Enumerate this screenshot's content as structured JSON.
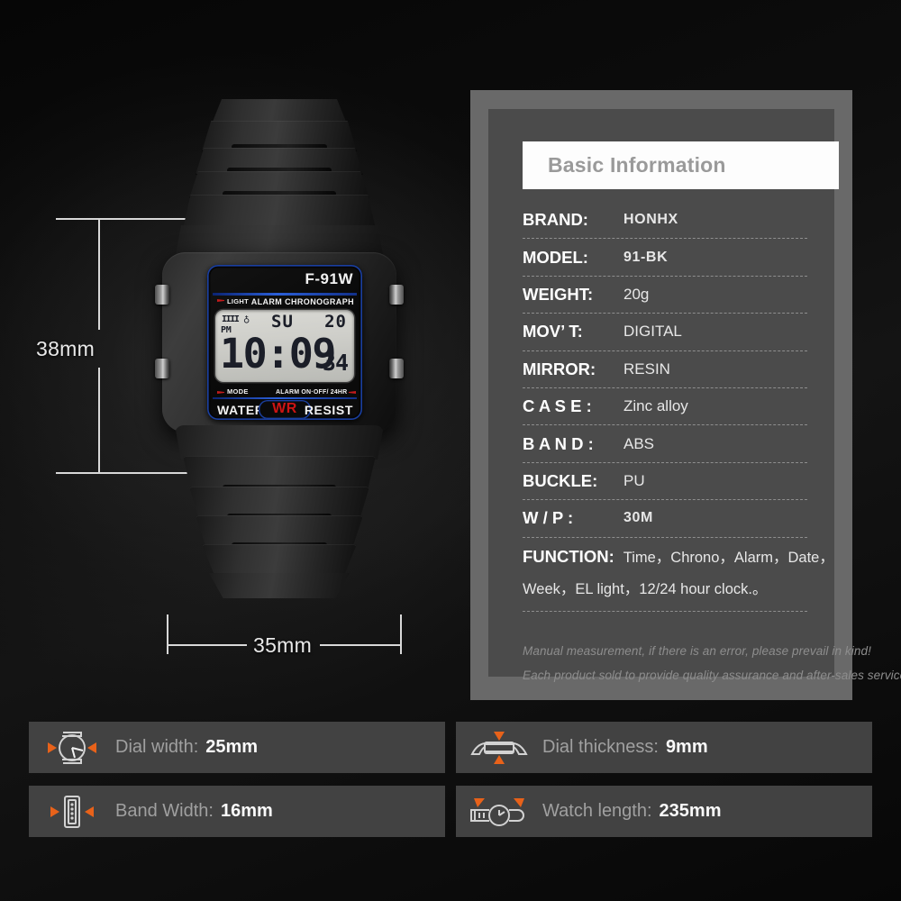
{
  "watch": {
    "model_text": "F-91W",
    "light_label": "LIGHT",
    "alarm_chrono_label": "ALARM CHRONOGRAPH",
    "mode_label": "MODE",
    "alarm_row_label": "ALARM  ON·OFF/ 24HR",
    "water_label": "WATER",
    "wr_label": "WR",
    "resist_label": "RESIST",
    "lcd": {
      "battery_bars": "IIII",
      "bell_icon": "♁",
      "meridiem": "PM",
      "weekday": "SU",
      "date": "20",
      "time": "10:09",
      "seconds": "34"
    }
  },
  "dimensions": {
    "height_label": "38mm",
    "width_label": "35mm"
  },
  "info": {
    "title": "Basic Information",
    "rows": [
      {
        "key": "BRAND:",
        "value": "HONHX",
        "bold": true,
        "wide": false
      },
      {
        "key": "MODEL:",
        "value": "91-BK",
        "bold": true,
        "wide": false
      },
      {
        "key": "WEIGHT:",
        "value": "20g",
        "bold": false,
        "wide": false
      },
      {
        "key": "MOV’ T:",
        "value": "DIGITAL",
        "bold": false,
        "wide": false
      },
      {
        "key": "MIRROR:",
        "value": "RESIN",
        "bold": false,
        "wide": false
      },
      {
        "key": "C A S E :",
        "value": "Zinc alloy",
        "bold": false,
        "wide": false
      },
      {
        "key": "B A N D :",
        "value": "ABS",
        "bold": false,
        "wide": false
      },
      {
        "key": "BUCKLE:",
        "value": "PU",
        "bold": false,
        "wide": false
      },
      {
        "key": "W / P :",
        "value": "30M",
        "bold": true,
        "wide": false
      }
    ],
    "function": {
      "key": "FUNCTION:",
      "line1": "Time，Chrono，Alarm，Date，",
      "line2": "Week，EL light，12/24 hour clock.。"
    },
    "note1": "Manual measurement, if there is an error, please prevail in kind!",
    "note2": "Each product sold to provide quality assurance and after-sales service!"
  },
  "bottom_bars": [
    {
      "icon": "dial-width-icon",
      "label": "Dial width:",
      "value": "25mm"
    },
    {
      "icon": "dial-thickness-icon",
      "label": "Dial thickness:",
      "value": "9mm"
    },
    {
      "icon": "band-width-icon",
      "label": "Band Width:",
      "value": "16mm"
    },
    {
      "icon": "watch-length-icon",
      "label": "Watch length:",
      "value": "235mm"
    }
  ],
  "colors": {
    "accent_orange": "#e8621a",
    "panel_outer": "#696969",
    "panel_inner": "#4b4b4b",
    "bar_bg": "#424242",
    "bezel_blue": "#1a3fa0",
    "wr_red": "#cc1414"
  }
}
